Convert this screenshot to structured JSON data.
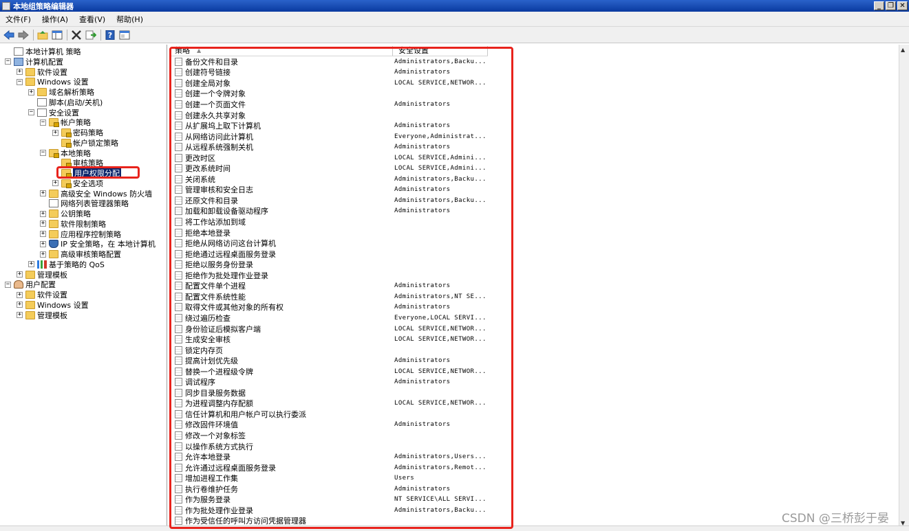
{
  "window": {
    "title": "本地组策略编辑器",
    "minimize": "_",
    "restore": "❐",
    "close": "✕"
  },
  "menu": [
    "文件(F)",
    "操作(A)",
    "查看(V)",
    "帮助(H)"
  ],
  "toolbar": [
    "back-icon",
    "forward-icon",
    "up-icon",
    "show-hide-tree-icon",
    "delete-icon",
    "export-icon",
    "help-icon",
    "properties-icon"
  ],
  "tree": [
    {
      "label": "本地计算机 策略",
      "level": 0,
      "exp": "",
      "icon": "doc",
      "name": "tree-local-computer-policy"
    },
    {
      "label": "计算机配置",
      "level": 0,
      "exp": "−",
      "icon": "comp",
      "name": "tree-computer-config"
    },
    {
      "label": "软件设置",
      "level": 1,
      "exp": "+",
      "icon": "folder",
      "name": "tree-software-settings"
    },
    {
      "label": "Windows 设置",
      "level": 1,
      "exp": "−",
      "icon": "folder",
      "name": "tree-windows-settings"
    },
    {
      "label": "域名解析策略",
      "level": 2,
      "exp": "+",
      "icon": "folder",
      "name": "tree-name-resolution"
    },
    {
      "label": "脚本(启动/关机)",
      "level": 2,
      "exp": "",
      "icon": "doc",
      "name": "tree-scripts"
    },
    {
      "label": "安全设置",
      "level": 2,
      "exp": "−",
      "icon": "doc",
      "name": "tree-security-settings"
    },
    {
      "label": "帐户策略",
      "level": 3,
      "exp": "−",
      "icon": "folder lock",
      "name": "tree-account-policies"
    },
    {
      "label": "密码策略",
      "level": 4,
      "exp": "+",
      "icon": "folder lock",
      "name": "tree-password-policy"
    },
    {
      "label": "帐户锁定策略",
      "level": 4,
      "exp": "",
      "icon": "folder lock",
      "name": "tree-lockout-policy"
    },
    {
      "label": "本地策略",
      "level": 3,
      "exp": "−",
      "icon": "folder lock",
      "name": "tree-local-policies"
    },
    {
      "label": "审核策略",
      "level": 4,
      "exp": "",
      "icon": "folder lock",
      "name": "tree-audit-policy"
    },
    {
      "label": "用户权限分配",
      "level": 4,
      "exp": "",
      "icon": "folder lock",
      "name": "tree-user-rights",
      "selected": true
    },
    {
      "label": "安全选项",
      "level": 4,
      "exp": "+",
      "icon": "folder lock",
      "name": "tree-security-options"
    },
    {
      "label": "高级安全 Windows 防火墙",
      "level": 3,
      "exp": "+",
      "icon": "folder",
      "name": "tree-firewall"
    },
    {
      "label": "网络列表管理器策略",
      "level": 3,
      "exp": "",
      "icon": "doc",
      "name": "tree-network-list"
    },
    {
      "label": "公钥策略",
      "level": 3,
      "exp": "+",
      "icon": "folder",
      "name": "tree-public-key"
    },
    {
      "label": "软件限制策略",
      "level": 3,
      "exp": "+",
      "icon": "folder",
      "name": "tree-software-restriction"
    },
    {
      "label": "应用程序控制策略",
      "level": 3,
      "exp": "+",
      "icon": "folder",
      "name": "tree-app-control"
    },
    {
      "label": "IP 安全策略，在 本地计算机",
      "level": 3,
      "exp": "+",
      "icon": "shield",
      "name": "tree-ip-security"
    },
    {
      "label": "高级审核策略配置",
      "level": 3,
      "exp": "+",
      "icon": "folder",
      "name": "tree-advanced-audit"
    },
    {
      "label": "基于策略的 QoS",
      "level": 2,
      "exp": "+",
      "icon": "bars",
      "name": "tree-qos"
    },
    {
      "label": "管理模板",
      "level": 1,
      "exp": "+",
      "icon": "folder",
      "name": "tree-admin-templates"
    },
    {
      "label": "用户配置",
      "level": 0,
      "exp": "−",
      "icon": "user",
      "name": "tree-user-config"
    },
    {
      "label": "软件设置",
      "level": 1,
      "exp": "+",
      "icon": "folder",
      "name": "tree-user-software"
    },
    {
      "label": "Windows 设置",
      "level": 1,
      "exp": "+",
      "icon": "folder",
      "name": "tree-user-windows"
    },
    {
      "label": "管理模板",
      "level": 1,
      "exp": "+",
      "icon": "folder",
      "name": "tree-user-admin-templates"
    }
  ],
  "list": {
    "col_policy": "策略",
    "col_setting": "安全设置",
    "sort_indicator": "▲",
    "rows": [
      {
        "policy": "备份文件和目录",
        "setting": "Administrators,Backu..."
      },
      {
        "policy": "创建符号链接",
        "setting": "Administrators"
      },
      {
        "policy": "创建全局对象",
        "setting": "LOCAL SERVICE,NETWOR..."
      },
      {
        "policy": "创建一个令牌对象",
        "setting": ""
      },
      {
        "policy": "创建一个页面文件",
        "setting": "Administrators"
      },
      {
        "policy": "创建永久共享对象",
        "setting": ""
      },
      {
        "policy": "从扩展坞上取下计算机",
        "setting": "Administrators"
      },
      {
        "policy": "从网络访问此计算机",
        "setting": "Everyone,Administrat..."
      },
      {
        "policy": "从远程系统强制关机",
        "setting": "Administrators"
      },
      {
        "policy": "更改时区",
        "setting": "LOCAL SERVICE,Admini..."
      },
      {
        "policy": "更改系统时间",
        "setting": "LOCAL SERVICE,Admini..."
      },
      {
        "policy": "关闭系统",
        "setting": "Administrators,Backu..."
      },
      {
        "policy": "管理审核和安全日志",
        "setting": "Administrators"
      },
      {
        "policy": "还原文件和目录",
        "setting": "Administrators,Backu..."
      },
      {
        "policy": "加载和卸载设备驱动程序",
        "setting": "Administrators"
      },
      {
        "policy": "将工作站添加到域",
        "setting": ""
      },
      {
        "policy": "拒绝本地登录",
        "setting": ""
      },
      {
        "policy": "拒绝从网络访问这台计算机",
        "setting": ""
      },
      {
        "policy": "拒绝通过远程桌面服务登录",
        "setting": ""
      },
      {
        "policy": "拒绝以服务身份登录",
        "setting": ""
      },
      {
        "policy": "拒绝作为批处理作业登录",
        "setting": ""
      },
      {
        "policy": "配置文件单个进程",
        "setting": "Administrators"
      },
      {
        "policy": "配置文件系统性能",
        "setting": "Administrators,NT SE..."
      },
      {
        "policy": "取得文件或其他对象的所有权",
        "setting": "Administrators"
      },
      {
        "policy": "绕过遍历检查",
        "setting": "Everyone,LOCAL SERVI..."
      },
      {
        "policy": "身份验证后模拟客户端",
        "setting": "LOCAL SERVICE,NETWOR..."
      },
      {
        "policy": "生成安全审核",
        "setting": "LOCAL SERVICE,NETWOR..."
      },
      {
        "policy": "锁定内存页",
        "setting": ""
      },
      {
        "policy": "提高计划优先级",
        "setting": "Administrators"
      },
      {
        "policy": "替换一个进程级令牌",
        "setting": "LOCAL SERVICE,NETWOR..."
      },
      {
        "policy": "调试程序",
        "setting": "Administrators"
      },
      {
        "policy": "同步目录服务数据",
        "setting": ""
      },
      {
        "policy": "为进程调整内存配额",
        "setting": "LOCAL SERVICE,NETWOR..."
      },
      {
        "policy": "信任计算机和用户帐户可以执行委派",
        "setting": ""
      },
      {
        "policy": "修改固件环境值",
        "setting": "Administrators"
      },
      {
        "policy": "修改一个对象标签",
        "setting": ""
      },
      {
        "policy": "以操作系统方式执行",
        "setting": ""
      },
      {
        "policy": "允许本地登录",
        "setting": "Administrators,Users..."
      },
      {
        "policy": "允许通过远程桌面服务登录",
        "setting": "Administrators,Remot..."
      },
      {
        "policy": "增加进程工作集",
        "setting": "Users"
      },
      {
        "policy": "执行卷维护任务",
        "setting": "Administrators"
      },
      {
        "policy": "作为服务登录",
        "setting": "NT SERVICE\\ALL SERVI..."
      },
      {
        "policy": "作为批处理作业登录",
        "setting": "Administrators,Backu..."
      },
      {
        "policy": "作为受信任的呼叫方访问凭据管理器",
        "setting": ""
      }
    ]
  },
  "watermark": "CSDN @三桥彭于晏"
}
